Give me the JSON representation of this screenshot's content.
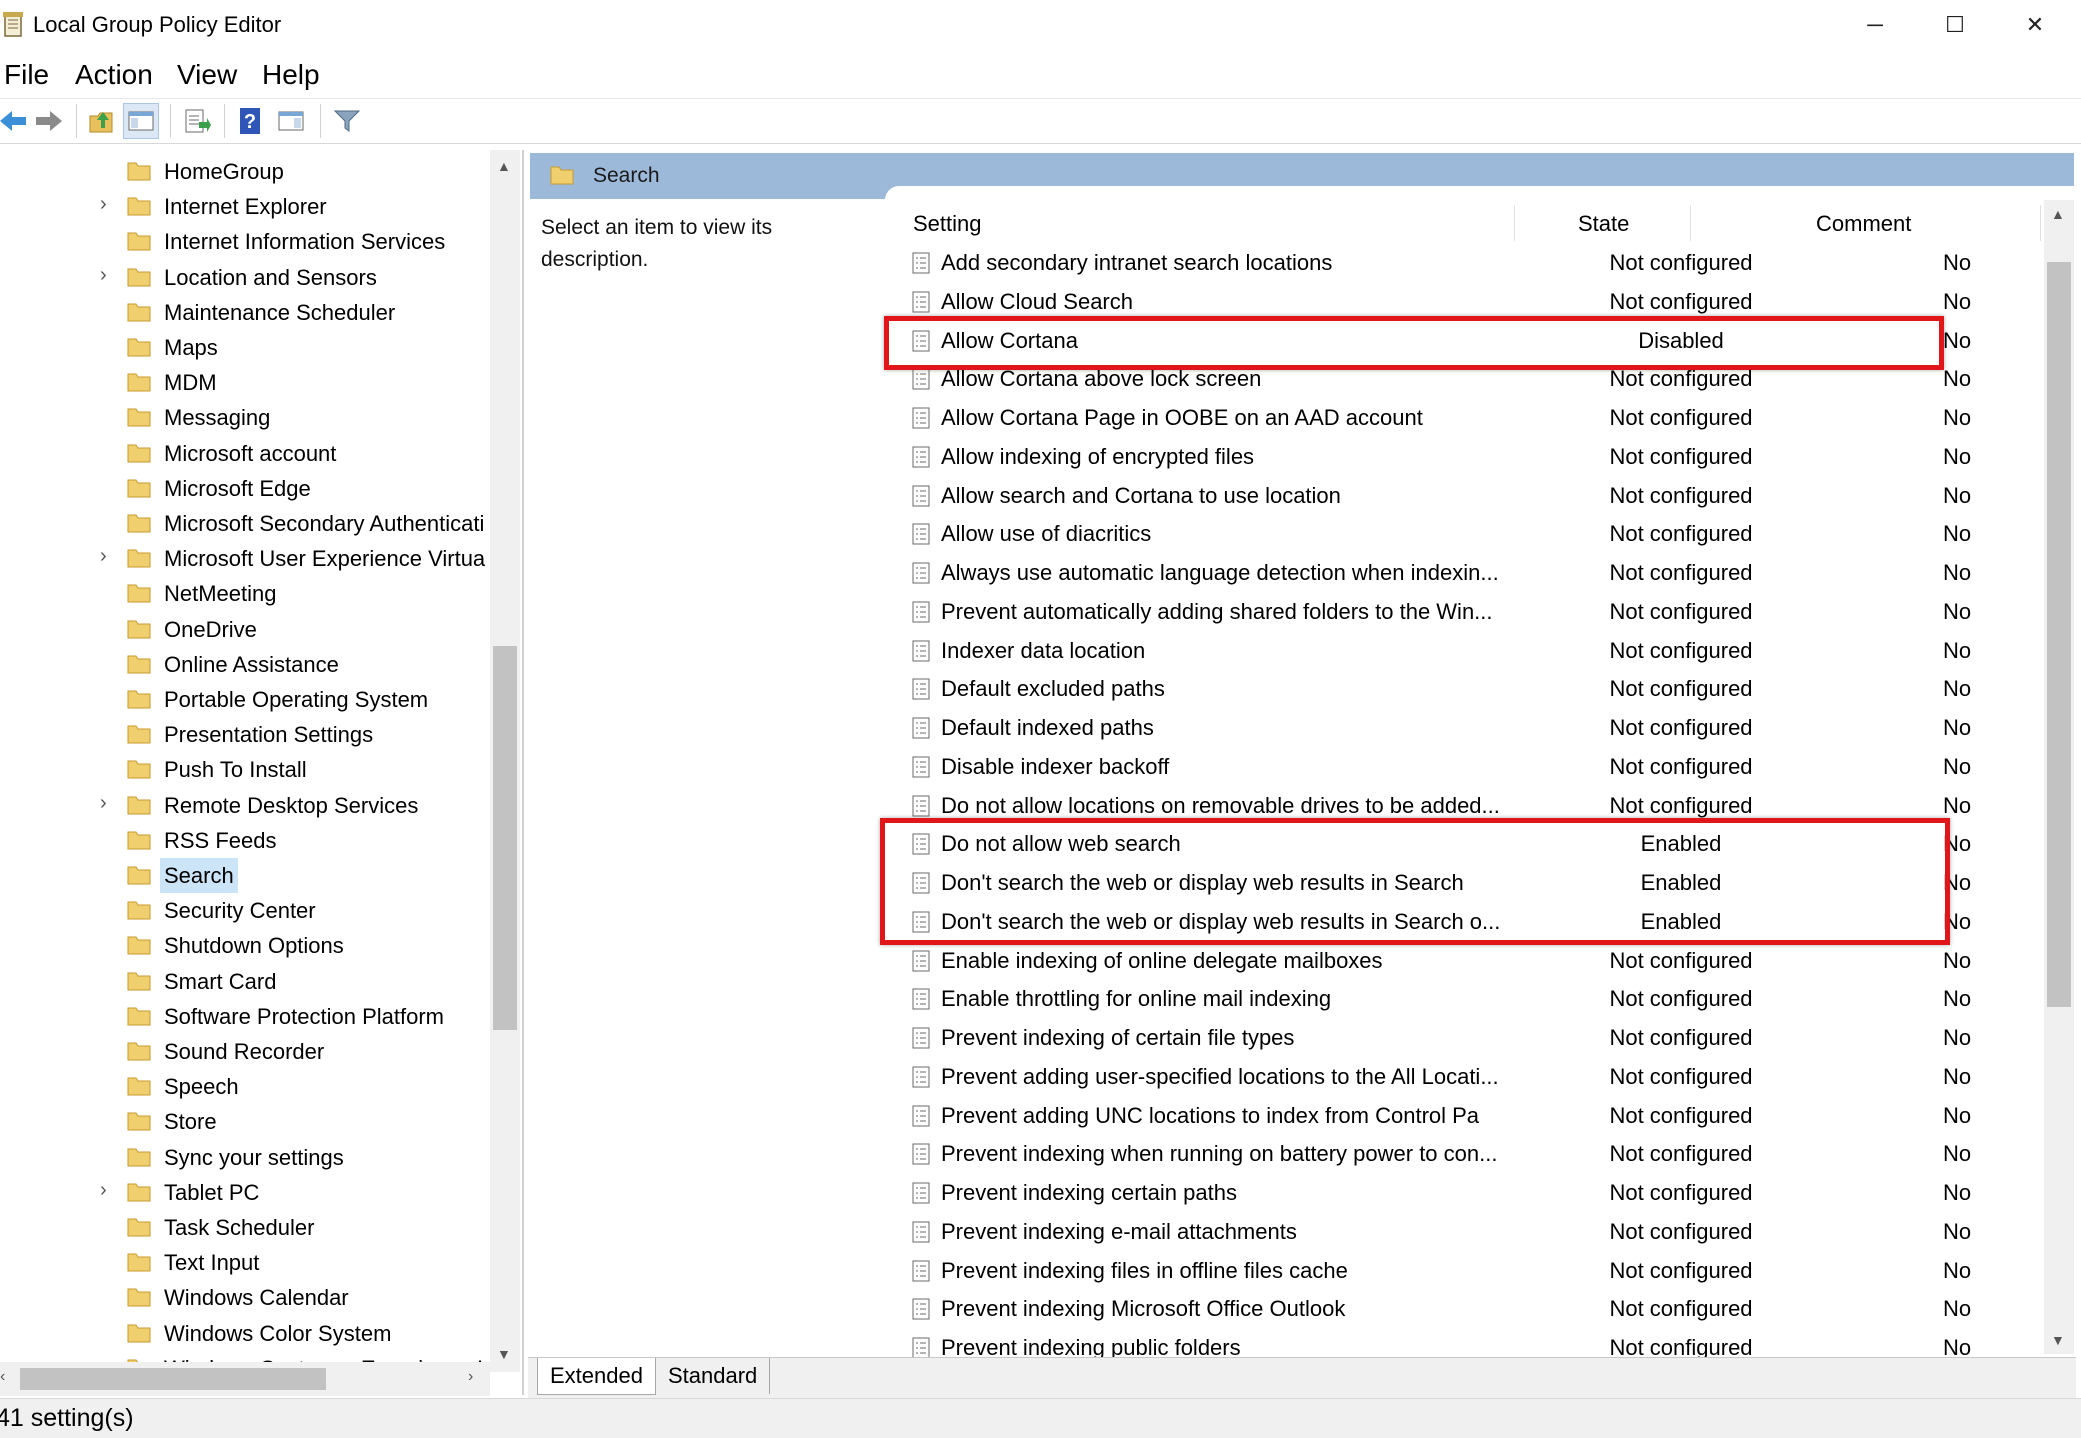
{
  "window": {
    "title": "Local Group Policy Editor",
    "minimize_glyph": "─",
    "maximize_glyph": "☐",
    "close_glyph": "✕"
  },
  "menu": [
    "File",
    "Action",
    "View",
    "Help"
  ],
  "tree": {
    "items": [
      {
        "label": "HomeGroup",
        "expandable": false
      },
      {
        "label": "Internet Explorer",
        "expandable": true
      },
      {
        "label": "Internet Information Services",
        "expandable": false
      },
      {
        "label": "Location and Sensors",
        "expandable": true
      },
      {
        "label": "Maintenance Scheduler",
        "expandable": false
      },
      {
        "label": "Maps",
        "expandable": false
      },
      {
        "label": "MDM",
        "expandable": false
      },
      {
        "label": "Messaging",
        "expandable": false
      },
      {
        "label": "Microsoft account",
        "expandable": false
      },
      {
        "label": "Microsoft Edge",
        "expandable": false
      },
      {
        "label": "Microsoft Secondary Authenticati",
        "expandable": false
      },
      {
        "label": "Microsoft User Experience Virtua",
        "expandable": true
      },
      {
        "label": "NetMeeting",
        "expandable": false
      },
      {
        "label": "OneDrive",
        "expandable": false
      },
      {
        "label": "Online Assistance",
        "expandable": false
      },
      {
        "label": "Portable Operating System",
        "expandable": false
      },
      {
        "label": "Presentation Settings",
        "expandable": false
      },
      {
        "label": "Push To Install",
        "expandable": false
      },
      {
        "label": "Remote Desktop Services",
        "expandable": true
      },
      {
        "label": "RSS Feeds",
        "expandable": false
      },
      {
        "label": "Search",
        "expandable": false,
        "selected": true
      },
      {
        "label": "Security Center",
        "expandable": false
      },
      {
        "label": "Shutdown Options",
        "expandable": false
      },
      {
        "label": "Smart Card",
        "expandable": false
      },
      {
        "label": "Software Protection Platform",
        "expandable": false
      },
      {
        "label": "Sound Recorder",
        "expandable": false
      },
      {
        "label": "Speech",
        "expandable": false
      },
      {
        "label": "Store",
        "expandable": false
      },
      {
        "label": "Sync your settings",
        "expandable": false
      },
      {
        "label": "Tablet PC",
        "expandable": true
      },
      {
        "label": "Task Scheduler",
        "expandable": false
      },
      {
        "label": "Text Input",
        "expandable": false
      },
      {
        "label": "Windows Calendar",
        "expandable": false
      },
      {
        "label": "Windows Color System",
        "expandable": false
      },
      {
        "label": "Windows Customer Experience I",
        "expandable": false
      }
    ]
  },
  "details": {
    "folder_title": "Search",
    "description": "Select an item to view its description.",
    "columns": {
      "setting": "Setting",
      "state": "State",
      "comment": "Comment"
    },
    "settings": [
      {
        "name": "Add secondary intranet search locations",
        "state": "Not configured",
        "comment": "No"
      },
      {
        "name": "Allow Cloud Search",
        "state": "Not configured",
        "comment": "No"
      },
      {
        "name": "Allow Cortana",
        "state": "Disabled",
        "comment": "No"
      },
      {
        "name": "Allow Cortana above lock screen",
        "state": "Not configured",
        "comment": "No"
      },
      {
        "name": "Allow Cortana Page in OOBE on an AAD account",
        "state": "Not configured",
        "comment": "No"
      },
      {
        "name": "Allow indexing of encrypted files",
        "state": "Not configured",
        "comment": "No"
      },
      {
        "name": "Allow search and Cortana to use location",
        "state": "Not configured",
        "comment": "No"
      },
      {
        "name": "Allow use of diacritics",
        "state": "Not configured",
        "comment": "No"
      },
      {
        "name": "Always use automatic language detection when indexin...",
        "state": "Not configured",
        "comment": "No"
      },
      {
        "name": "Prevent automatically adding shared folders to the Win...",
        "state": "Not configured",
        "comment": "No"
      },
      {
        "name": "Indexer data location",
        "state": "Not configured",
        "comment": "No"
      },
      {
        "name": "Default excluded paths",
        "state": "Not configured",
        "comment": "No"
      },
      {
        "name": "Default indexed paths",
        "state": "Not configured",
        "comment": "No"
      },
      {
        "name": "Disable indexer backoff",
        "state": "Not configured",
        "comment": "No"
      },
      {
        "name": "Do not allow locations on removable drives to be added...",
        "state": "Not configured",
        "comment": "No"
      },
      {
        "name": "Do not allow web search",
        "state": "Enabled",
        "comment": "No"
      },
      {
        "name": "Don't search the web or display web results in Search",
        "state": "Enabled",
        "comment": "No"
      },
      {
        "name": "Don't search the web or display web results in Search o...",
        "state": "Enabled",
        "comment": "No"
      },
      {
        "name": "Enable indexing of online delegate mailboxes",
        "state": "Not configured",
        "comment": "No"
      },
      {
        "name": "Enable throttling for online mail indexing",
        "state": "Not configured",
        "comment": "No"
      },
      {
        "name": "Prevent indexing of certain file types",
        "state": "Not configured",
        "comment": "No"
      },
      {
        "name": "Prevent adding user-specified locations to the All Locati...",
        "state": "Not configured",
        "comment": "No"
      },
      {
        "name": "Prevent adding UNC locations to index from Control Pa",
        "state": "Not configured",
        "comment": "No"
      },
      {
        "name": "Prevent indexing when running on battery power to con...",
        "state": "Not configured",
        "comment": "No"
      },
      {
        "name": "Prevent indexing certain paths",
        "state": "Not configured",
        "comment": "No"
      },
      {
        "name": "Prevent indexing e-mail attachments",
        "state": "Not configured",
        "comment": "No"
      },
      {
        "name": "Prevent indexing files in offline files cache",
        "state": "Not configured",
        "comment": "No"
      },
      {
        "name": "Prevent indexing Microsoft Office Outlook",
        "state": "Not configured",
        "comment": "No"
      },
      {
        "name": "Prevent indexing public folders",
        "state": "Not configured",
        "comment": "No"
      }
    ]
  },
  "tabs": [
    "Extended",
    "Standard"
  ],
  "status": {
    "text": "41 setting(s)"
  },
  "colors": {
    "highlight": "#e0161b",
    "header": "#9db9d9",
    "selection": "#cce4f7"
  }
}
